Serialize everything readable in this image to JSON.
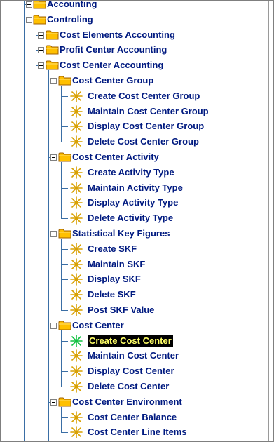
{
  "tree": [
    {
      "label": "Accounting",
      "level": 0,
      "type": "folder",
      "state": "collapsed"
    },
    {
      "label": "Controling",
      "level": 0,
      "type": "folder",
      "state": "expanded"
    },
    {
      "label": "Cost Elements Accounting",
      "level": 1,
      "type": "folder",
      "state": "collapsed"
    },
    {
      "label": "Profit Center Accounting",
      "level": 1,
      "type": "folder",
      "state": "collapsed"
    },
    {
      "label": "Cost Center Accounting",
      "level": 1,
      "type": "folder",
      "state": "expanded"
    },
    {
      "label": "Cost Center Group",
      "level": 2,
      "type": "folder",
      "state": "expanded"
    },
    {
      "label": "Create Cost Center Group",
      "level": 3,
      "type": "leaf"
    },
    {
      "label": "Maintain Cost Center Group",
      "level": 3,
      "type": "leaf"
    },
    {
      "label": "Display Cost Center Group",
      "level": 3,
      "type": "leaf"
    },
    {
      "label": "Delete Cost Center Group",
      "level": 3,
      "type": "leaf"
    },
    {
      "label": "Cost Center Activity",
      "level": 2,
      "type": "folder",
      "state": "expanded"
    },
    {
      "label": "Create Activity Type",
      "level": 3,
      "type": "leaf"
    },
    {
      "label": "Maintain Activity Type",
      "level": 3,
      "type": "leaf"
    },
    {
      "label": "Display Activity Type",
      "level": 3,
      "type": "leaf"
    },
    {
      "label": "Delete Activity Type",
      "level": 3,
      "type": "leaf"
    },
    {
      "label": "Statistical Key Figures",
      "level": 2,
      "type": "folder",
      "state": "expanded"
    },
    {
      "label": "Create SKF",
      "level": 3,
      "type": "leaf"
    },
    {
      "label": "Maintain SKF",
      "level": 3,
      "type": "leaf"
    },
    {
      "label": "Display SKF",
      "level": 3,
      "type": "leaf"
    },
    {
      "label": "Delete SKF",
      "level": 3,
      "type": "leaf"
    },
    {
      "label": "Post SKF Value",
      "level": 3,
      "type": "leaf"
    },
    {
      "label": "Cost Center",
      "level": 2,
      "type": "folder",
      "state": "expanded"
    },
    {
      "label": "Create Cost Center",
      "level": 3,
      "type": "leaf",
      "selected": true
    },
    {
      "label": "Maintain Cost Center",
      "level": 3,
      "type": "leaf"
    },
    {
      "label": "Display Cost Center",
      "level": 3,
      "type": "leaf"
    },
    {
      "label": "Delete Cost Center",
      "level": 3,
      "type": "leaf"
    },
    {
      "label": "Cost Center Environment",
      "level": 2,
      "type": "folder",
      "state": "expanded"
    },
    {
      "label": "Cost Center Balance",
      "level": 3,
      "type": "leaf"
    },
    {
      "label": "Cost Center Line Items",
      "level": 3,
      "type": "leaf"
    }
  ],
  "icons": {
    "folder": "folder-icon",
    "leaf": "transaction-star-icon",
    "leaf_selected": "transaction-star-selected-icon",
    "expand": "expand-plus-icon",
    "collapse": "collapse-minus-icon"
  },
  "colors": {
    "label": "#001a80",
    "selected_bg": "#000000",
    "selected_text": "#ffff66",
    "tree_line": "#3a6ea5",
    "folder_fill": "#ffc000",
    "star": "#d8a000",
    "star_selected": "#10c040"
  }
}
